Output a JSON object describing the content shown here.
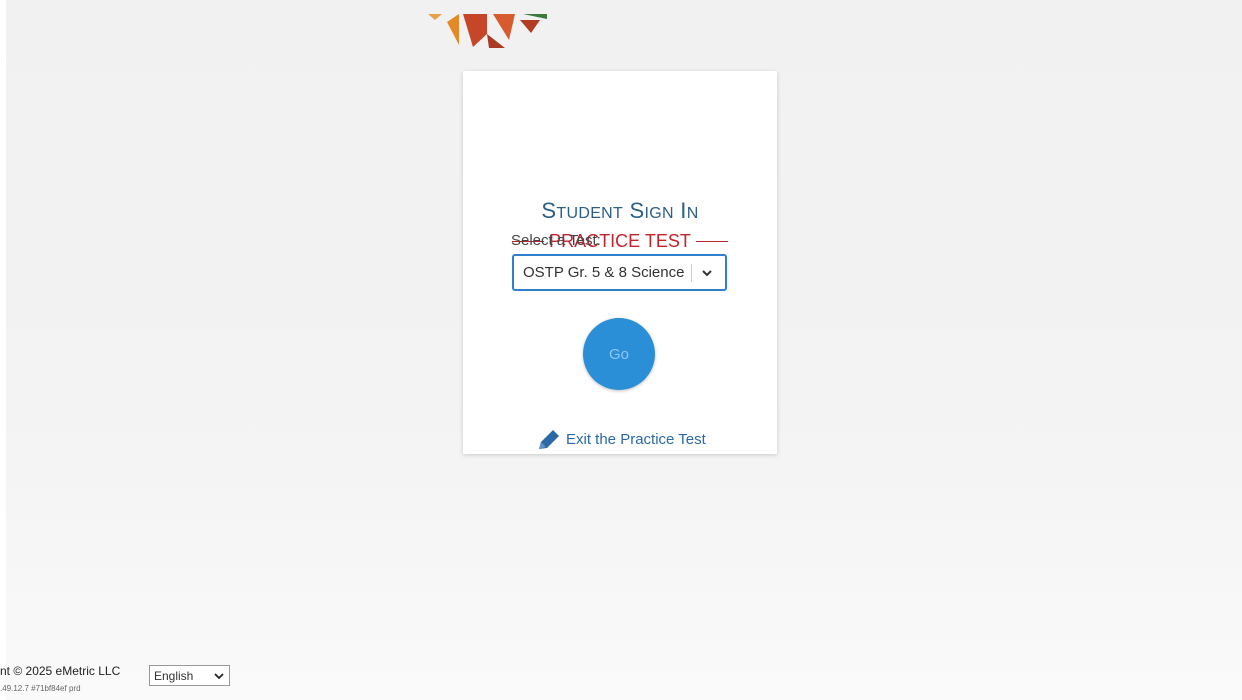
{
  "card": {
    "title_first_initial": "S",
    "title_first_rest": "TUDENT",
    "title_second_initial": "S",
    "title_second_rest": "IGN",
    "title_third_initial": "I",
    "title_third_rest": "N",
    "practice_label": "PRACTICE TEST",
    "subject": "OSTP Gr. 5 & 8 Science",
    "select_label": "Select a Test:",
    "selected_test": "OSTP Gr. 5 & 8 Science",
    "go_label": "Go",
    "exit_label": "Exit the Practice Test"
  },
  "footer": {
    "copyright": "nt © 2025 eMetric LLC",
    "version": ".49.12.7  #71bf84ef  prd",
    "language": "English"
  },
  "icons": {
    "logo": "logo-icon",
    "select_chevron": "chevron-down-icon",
    "exit": "pencil-icon",
    "language_chevron": "chevron-down-icon"
  },
  "colors": {
    "title": "#2b5f86",
    "practice": "#c0242b",
    "go_button": "#2a8fd6",
    "select_border": "#2f7fd1",
    "link": "#2b6aa6"
  }
}
